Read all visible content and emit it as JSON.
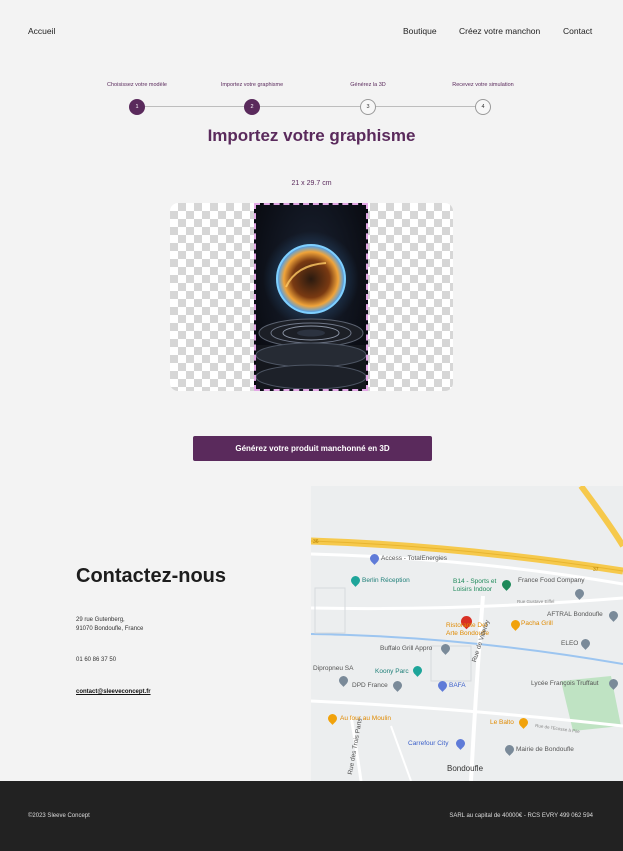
{
  "nav": {
    "home": "Accueil",
    "items": [
      "Boutique",
      "Créez votre manchon",
      "Contact"
    ]
  },
  "steps": [
    {
      "label": "Choisissez votre modèle",
      "number": "1",
      "state": "done"
    },
    {
      "label": "Importez votre graphisme",
      "number": "2",
      "state": "active"
    },
    {
      "label": "Générez la 3D",
      "number": "3",
      "state": "pending"
    },
    {
      "label": "Recevez votre simulation",
      "number": "4",
      "state": "pending"
    }
  ],
  "page": {
    "title": "Importez votre graphisme",
    "dimensions": "21 x 29.7 cm",
    "cta": "Générez votre produit manchonné en 3D"
  },
  "contact": {
    "heading": "Contactez-nous",
    "address_line1": "29 rue Gutenberg,",
    "address_line2": "91070 Bondoufle, France",
    "phone": "01 60 86 37 50",
    "email": "contact@sleeveconcept.fr"
  },
  "map": {
    "labels": {
      "access": "Access - TotalEnergies",
      "berlin": "Berlin Réception",
      "b14": "B14 - Sports et Loisirs Indoor",
      "france_food": "France Food Company",
      "rue_eiffel": "Rue Gustave Eiffel",
      "aftral": "AFTRAL Bondoufle",
      "pacha": "Pacha Grill",
      "ristorante": "Ristorante Del Arte Bondoufle",
      "buffalo": "Buffalo Grill Appro",
      "eleo": "ELEO",
      "dipropneu": "Dipropneu SA",
      "koony": "Koony Parc",
      "dpd": "DPD France",
      "bafa": "BAFA",
      "lycee": "Lycée François Truffaut",
      "rue_villeroy": "Rue de Villeroy",
      "aufour": "Au four au Moulin",
      "balto": "Le Balto",
      "ecosse": "Rue de l'Ecosse à Pile",
      "carrefour": "Carrefour City",
      "mairie": "Mairie de Bondoufle",
      "bondoufle": "Bondoufle",
      "rue_trois": "Rue des Trois Parts",
      "road_37": "37",
      "road_36": "36"
    },
    "colors": {
      "road": "#f6c94c",
      "water": "#9cc5f0",
      "park": "#bfe3c3",
      "pin": "#d93025"
    }
  },
  "footer": {
    "left": "©2023 Sleeve Concept",
    "right": "SARL au capital de 40000€ - RCS EVRY 499 062 594"
  }
}
